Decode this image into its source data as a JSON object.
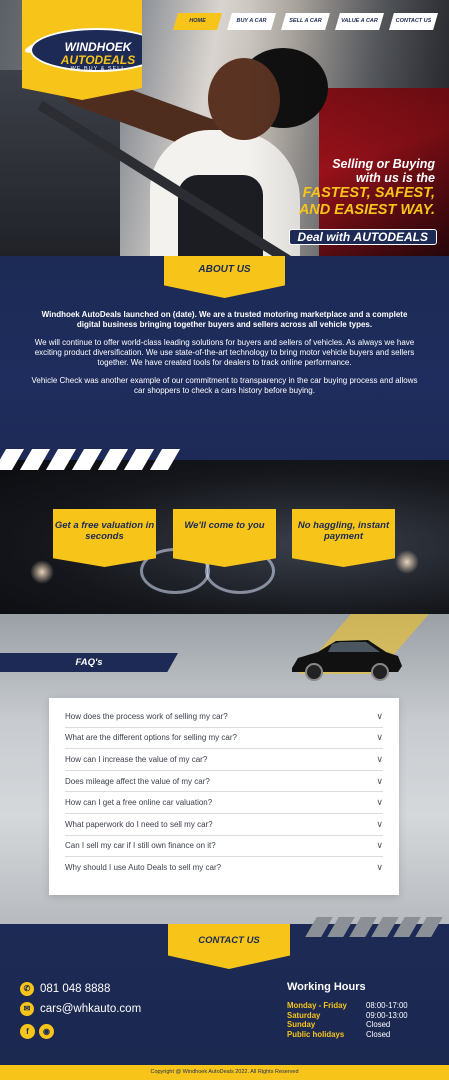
{
  "logo": {
    "line1": "WINDHOEK",
    "line2": "AUTODEALS",
    "tagline": "WE BUY & SELL"
  },
  "nav": {
    "items": [
      {
        "label": "HOME"
      },
      {
        "label": "BUY A CAR"
      },
      {
        "label": "SELL A CAR"
      },
      {
        "label": "VALUE A CAR"
      },
      {
        "label": "CONTACT US"
      }
    ],
    "active": "HOME"
  },
  "hero": {
    "line1": "Selling or Buying",
    "line2": "with us is the",
    "line3": "FASTEST, SAFEST,",
    "line4": "AND EASIEST WAY.",
    "pill_prefix": "Deal with ",
    "pill_brand": "AUTODEALS"
  },
  "about": {
    "heading": "ABOUT US",
    "p1": "Windhoek AutoDeals launched on (date). We are a trusted motoring marketplace and a complete digital business bringing together buyers and sellers across all vehicle types.",
    "p2": "We will continue to offer world-class leading solutions for buyers and sellers of vehicles. As always we have exciting product diversification. We use state-of-the-art technology to bring motor vehicle buyers and sellers together. We have created tools for dealers to track online performance.",
    "p3": "Vehicle Check was another example of our commitment to transparency in the car buying process and allows car shoppers to check a cars history before buying."
  },
  "features": [
    {
      "label": "Get a free valuation in seconds"
    },
    {
      "label": "We'll come to you"
    },
    {
      "label": "No haggling, instant payment"
    }
  ],
  "faq": {
    "heading": "FAQ's",
    "items": [
      {
        "q": "How does the process work of selling my car?"
      },
      {
        "q": "What are the different options for selling my car?"
      },
      {
        "q": "How can I increase the value of my car?"
      },
      {
        "q": "Does mileage affect the value of my car?"
      },
      {
        "q": "How can I get a free online car valuation?"
      },
      {
        "q": "What paperwork do I need to sell my car?"
      },
      {
        "q": "Can I sell my car if I still own finance on it?"
      },
      {
        "q": "Why should I use Auto Deals to sell my car?"
      }
    ],
    "chevron": "∨"
  },
  "contact": {
    "heading": "CONTACT US",
    "phone": "081 048 8888",
    "email": "cars@whkauto.com",
    "icons": [
      "phone-icon",
      "email-icon",
      "facebook-icon",
      "instagram-icon"
    ],
    "hours_title": "Working Hours",
    "hours": [
      {
        "day": "Monday - Friday",
        "time": "08:00-17:00"
      },
      {
        "day": "Saturday",
        "time": "09:00-13:00"
      },
      {
        "day": "Sunday",
        "time": "Closed"
      },
      {
        "day": "Public holidays",
        "time": "Closed"
      }
    ]
  },
  "footer": {
    "copyright": "Copyright @ Windhoek AutoDeals 2022. All Rights Reserved"
  },
  "colors": {
    "navy": "#1c2a55",
    "yellow": "#f7c51a",
    "white": "#ffffff"
  }
}
